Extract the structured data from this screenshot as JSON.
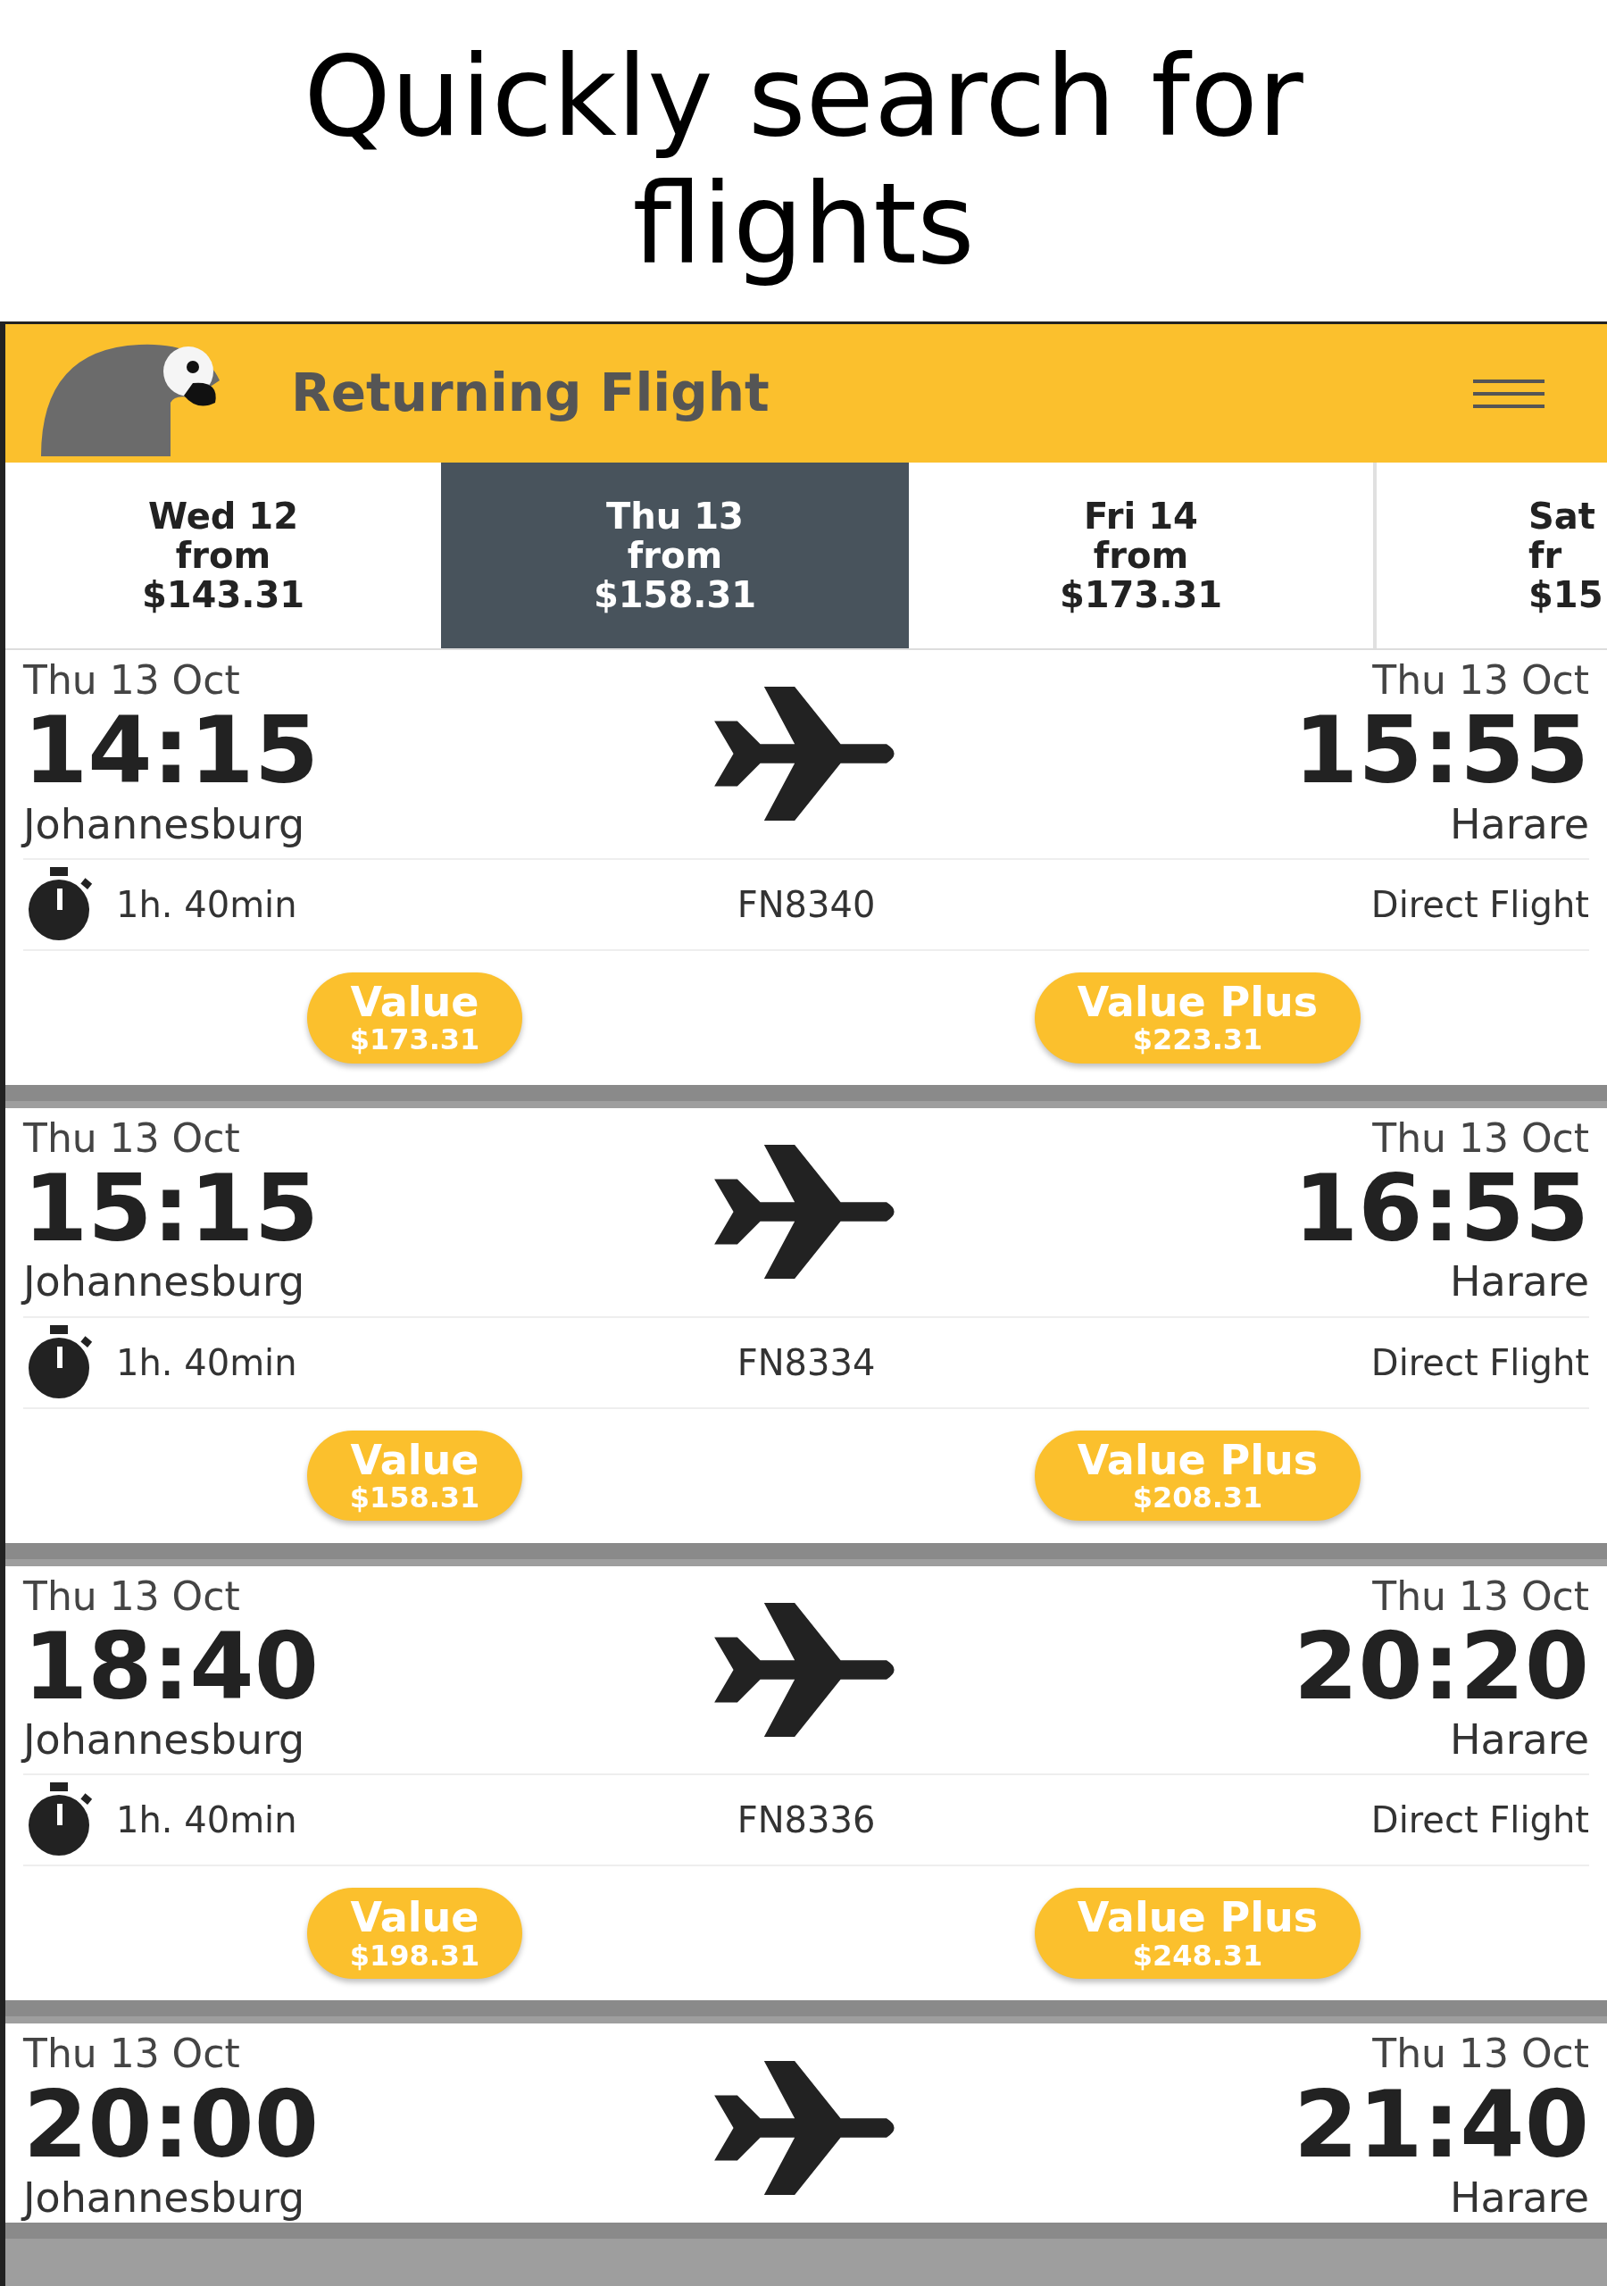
{
  "headline": "Quickly search for flights",
  "app_bar": {
    "title": "Returning Flight"
  },
  "date_tabs": [
    {
      "day": "Wed 12",
      "from": "from",
      "price": "$143.31",
      "selected": false
    },
    {
      "day": "Thu 13",
      "from": "from",
      "price": "$158.31",
      "selected": true
    },
    {
      "day": "Fri 14",
      "from": "from",
      "price": "$173.31",
      "selected": false
    },
    {
      "day": "Sat",
      "from": "fr",
      "price": "$15",
      "selected": false
    }
  ],
  "flights": [
    {
      "depart_date": "Thu 13 Oct",
      "depart_time": "14:15",
      "origin": "Johannesburg",
      "arrive_date": "Thu 13 Oct",
      "arrive_time": "15:55",
      "destination": "Harare",
      "duration": "1h. 40min",
      "flight_number": "FN8340",
      "stops": "Direct Flight",
      "fares": [
        {
          "name": "Value",
          "price": "$173.31"
        },
        {
          "name": "Value Plus",
          "price": "$223.31"
        }
      ]
    },
    {
      "depart_date": "Thu 13 Oct",
      "depart_time": "15:15",
      "origin": "Johannesburg",
      "arrive_date": "Thu 13 Oct",
      "arrive_time": "16:55",
      "destination": "Harare",
      "duration": "1h. 40min",
      "flight_number": "FN8334",
      "stops": "Direct Flight",
      "fares": [
        {
          "name": "Value",
          "price": "$158.31"
        },
        {
          "name": "Value Plus",
          "price": "$208.31"
        }
      ]
    },
    {
      "depart_date": "Thu 13 Oct",
      "depart_time": "18:40",
      "origin": "Johannesburg",
      "arrive_date": "Thu 13 Oct",
      "arrive_time": "20:20",
      "destination": "Harare",
      "duration": "1h. 40min",
      "flight_number": "FN8336",
      "stops": "Direct Flight",
      "fares": [
        {
          "name": "Value",
          "price": "$198.31"
        },
        {
          "name": "Value Plus",
          "price": "$248.31"
        }
      ]
    },
    {
      "depart_date": "Thu 13 Oct",
      "depart_time": "20:00",
      "origin": "Johannesburg",
      "arrive_date": "Thu 13 Oct",
      "arrive_time": "21:40",
      "destination": "Harare"
    }
  ]
}
